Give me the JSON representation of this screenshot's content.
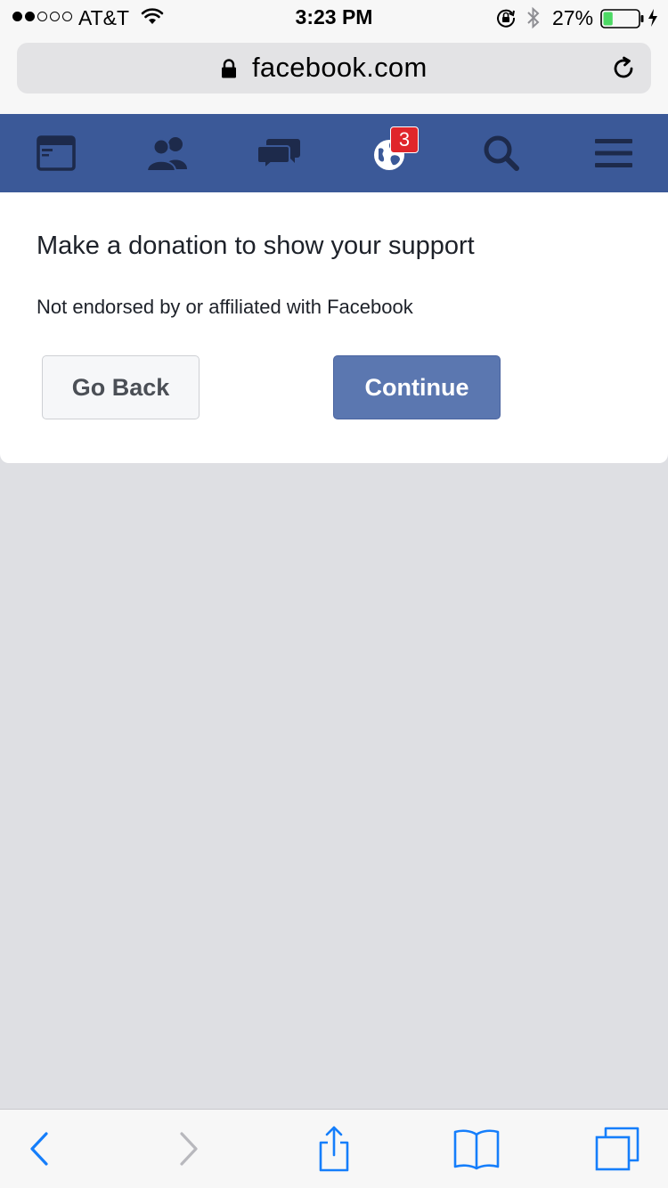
{
  "status_bar": {
    "carrier": "AT&T",
    "time": "3:23 PM",
    "battery_percent": "27%",
    "battery_level": 0.27,
    "signal_bars_filled": 2,
    "signal_bars_total": 5
  },
  "browser": {
    "url": "facebook.com"
  },
  "fb_nav": {
    "notifications_badge": "3",
    "brand_color": "#3b5998"
  },
  "dialog": {
    "title": "Make a donation to show your support",
    "subtitle": "Not endorsed by or affiliated with Facebook",
    "go_back_label": "Go Back",
    "continue_label": "Continue"
  },
  "icons": {
    "nav": [
      "news-feed-icon",
      "friend-requests-icon",
      "messages-icon",
      "notifications-globe-icon",
      "search-icon",
      "menu-icon"
    ],
    "toolbar": [
      "back-chevron-icon",
      "forward-chevron-icon",
      "share-icon",
      "bookmarks-icon",
      "tabs-icon"
    ]
  },
  "colors": {
    "ios_blue": "#157efb",
    "disabled_gray": "#b8b8bd",
    "continue_button": "#5b77b0",
    "badge_red": "#e0262b"
  }
}
